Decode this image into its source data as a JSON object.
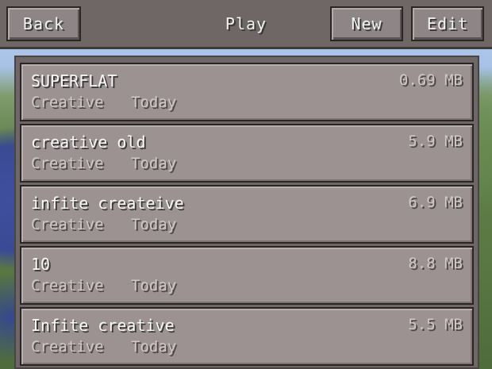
{
  "header": {
    "back_label": "Back",
    "title": "Play",
    "new_label": "New",
    "edit_label": "Edit"
  },
  "worlds": [
    {
      "name": "SUPERFLAT",
      "size": "0.69 MB",
      "mode": "Creative",
      "date": "Today"
    },
    {
      "name": "creative old",
      "size": "5.9 MB",
      "mode": "Creative",
      "date": "Today"
    },
    {
      "name": "infite createive",
      "size": "6.9 MB",
      "mode": "Creative",
      "date": "Today"
    },
    {
      "name": "10",
      "size": "8.8 MB",
      "mode": "Creative",
      "date": "Today"
    },
    {
      "name": "Infite creative",
      "size": "5.5 MB",
      "mode": "Creative",
      "date": "Today"
    }
  ],
  "colors": {
    "button_face": "#8e8686",
    "row_face": "#9d9292",
    "top_bar": "#6f6666",
    "text_primary": "#f7f7f7",
    "text_secondary": "#cfc7c7"
  }
}
